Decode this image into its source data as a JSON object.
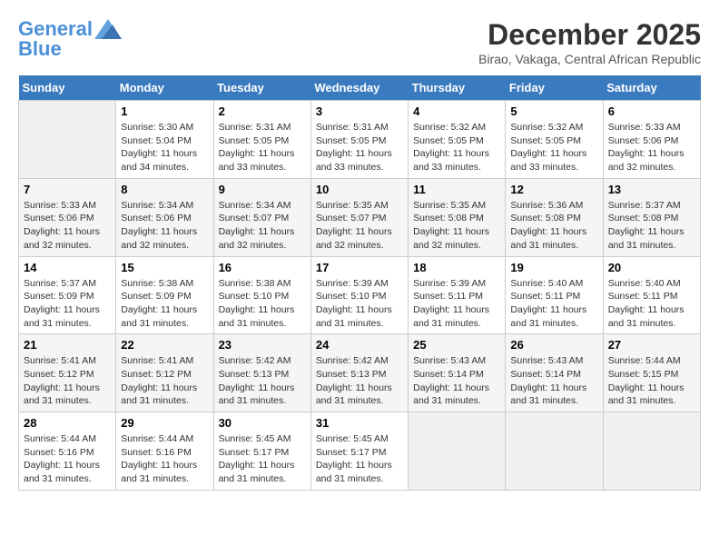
{
  "logo": {
    "text_general": "General",
    "text_blue": "Blue"
  },
  "title": "December 2025",
  "subtitle": "Birao, Vakaga, Central African Republic",
  "days_of_week": [
    "Sunday",
    "Monday",
    "Tuesday",
    "Wednesday",
    "Thursday",
    "Friday",
    "Saturday"
  ],
  "weeks": [
    [
      {
        "day": "",
        "sunrise": "",
        "sunset": "",
        "daylight": ""
      },
      {
        "day": "1",
        "sunrise": "Sunrise: 5:30 AM",
        "sunset": "Sunset: 5:04 PM",
        "daylight": "Daylight: 11 hours and 34 minutes."
      },
      {
        "day": "2",
        "sunrise": "Sunrise: 5:31 AM",
        "sunset": "Sunset: 5:05 PM",
        "daylight": "Daylight: 11 hours and 33 minutes."
      },
      {
        "day": "3",
        "sunrise": "Sunrise: 5:31 AM",
        "sunset": "Sunset: 5:05 PM",
        "daylight": "Daylight: 11 hours and 33 minutes."
      },
      {
        "day": "4",
        "sunrise": "Sunrise: 5:32 AM",
        "sunset": "Sunset: 5:05 PM",
        "daylight": "Daylight: 11 hours and 33 minutes."
      },
      {
        "day": "5",
        "sunrise": "Sunrise: 5:32 AM",
        "sunset": "Sunset: 5:05 PM",
        "daylight": "Daylight: 11 hours and 33 minutes."
      },
      {
        "day": "6",
        "sunrise": "Sunrise: 5:33 AM",
        "sunset": "Sunset: 5:06 PM",
        "daylight": "Daylight: 11 hours and 32 minutes."
      }
    ],
    [
      {
        "day": "7",
        "sunrise": "Sunrise: 5:33 AM",
        "sunset": "Sunset: 5:06 PM",
        "daylight": "Daylight: 11 hours and 32 minutes."
      },
      {
        "day": "8",
        "sunrise": "Sunrise: 5:34 AM",
        "sunset": "Sunset: 5:06 PM",
        "daylight": "Daylight: 11 hours and 32 minutes."
      },
      {
        "day": "9",
        "sunrise": "Sunrise: 5:34 AM",
        "sunset": "Sunset: 5:07 PM",
        "daylight": "Daylight: 11 hours and 32 minutes."
      },
      {
        "day": "10",
        "sunrise": "Sunrise: 5:35 AM",
        "sunset": "Sunset: 5:07 PM",
        "daylight": "Daylight: 11 hours and 32 minutes."
      },
      {
        "day": "11",
        "sunrise": "Sunrise: 5:35 AM",
        "sunset": "Sunset: 5:08 PM",
        "daylight": "Daylight: 11 hours and 32 minutes."
      },
      {
        "day": "12",
        "sunrise": "Sunrise: 5:36 AM",
        "sunset": "Sunset: 5:08 PM",
        "daylight": "Daylight: 11 hours and 31 minutes."
      },
      {
        "day": "13",
        "sunrise": "Sunrise: 5:37 AM",
        "sunset": "Sunset: 5:08 PM",
        "daylight": "Daylight: 11 hours and 31 minutes."
      }
    ],
    [
      {
        "day": "14",
        "sunrise": "Sunrise: 5:37 AM",
        "sunset": "Sunset: 5:09 PM",
        "daylight": "Daylight: 11 hours and 31 minutes."
      },
      {
        "day": "15",
        "sunrise": "Sunrise: 5:38 AM",
        "sunset": "Sunset: 5:09 PM",
        "daylight": "Daylight: 11 hours and 31 minutes."
      },
      {
        "day": "16",
        "sunrise": "Sunrise: 5:38 AM",
        "sunset": "Sunset: 5:10 PM",
        "daylight": "Daylight: 11 hours and 31 minutes."
      },
      {
        "day": "17",
        "sunrise": "Sunrise: 5:39 AM",
        "sunset": "Sunset: 5:10 PM",
        "daylight": "Daylight: 11 hours and 31 minutes."
      },
      {
        "day": "18",
        "sunrise": "Sunrise: 5:39 AM",
        "sunset": "Sunset: 5:11 PM",
        "daylight": "Daylight: 11 hours and 31 minutes."
      },
      {
        "day": "19",
        "sunrise": "Sunrise: 5:40 AM",
        "sunset": "Sunset: 5:11 PM",
        "daylight": "Daylight: 11 hours and 31 minutes."
      },
      {
        "day": "20",
        "sunrise": "Sunrise: 5:40 AM",
        "sunset": "Sunset: 5:11 PM",
        "daylight": "Daylight: 11 hours and 31 minutes."
      }
    ],
    [
      {
        "day": "21",
        "sunrise": "Sunrise: 5:41 AM",
        "sunset": "Sunset: 5:12 PM",
        "daylight": "Daylight: 11 hours and 31 minutes."
      },
      {
        "day": "22",
        "sunrise": "Sunrise: 5:41 AM",
        "sunset": "Sunset: 5:12 PM",
        "daylight": "Daylight: 11 hours and 31 minutes."
      },
      {
        "day": "23",
        "sunrise": "Sunrise: 5:42 AM",
        "sunset": "Sunset: 5:13 PM",
        "daylight": "Daylight: 11 hours and 31 minutes."
      },
      {
        "day": "24",
        "sunrise": "Sunrise: 5:42 AM",
        "sunset": "Sunset: 5:13 PM",
        "daylight": "Daylight: 11 hours and 31 minutes."
      },
      {
        "day": "25",
        "sunrise": "Sunrise: 5:43 AM",
        "sunset": "Sunset: 5:14 PM",
        "daylight": "Daylight: 11 hours and 31 minutes."
      },
      {
        "day": "26",
        "sunrise": "Sunrise: 5:43 AM",
        "sunset": "Sunset: 5:14 PM",
        "daylight": "Daylight: 11 hours and 31 minutes."
      },
      {
        "day": "27",
        "sunrise": "Sunrise: 5:44 AM",
        "sunset": "Sunset: 5:15 PM",
        "daylight": "Daylight: 11 hours and 31 minutes."
      }
    ],
    [
      {
        "day": "28",
        "sunrise": "Sunrise: 5:44 AM",
        "sunset": "Sunset: 5:16 PM",
        "daylight": "Daylight: 11 hours and 31 minutes."
      },
      {
        "day": "29",
        "sunrise": "Sunrise: 5:44 AM",
        "sunset": "Sunset: 5:16 PM",
        "daylight": "Daylight: 11 hours and 31 minutes."
      },
      {
        "day": "30",
        "sunrise": "Sunrise: 5:45 AM",
        "sunset": "Sunset: 5:17 PM",
        "daylight": "Daylight: 11 hours and 31 minutes."
      },
      {
        "day": "31",
        "sunrise": "Sunrise: 5:45 AM",
        "sunset": "Sunset: 5:17 PM",
        "daylight": "Daylight: 11 hours and 31 minutes."
      },
      {
        "day": "",
        "sunrise": "",
        "sunset": "",
        "daylight": ""
      },
      {
        "day": "",
        "sunrise": "",
        "sunset": "",
        "daylight": ""
      },
      {
        "day": "",
        "sunrise": "",
        "sunset": "",
        "daylight": ""
      }
    ]
  ]
}
